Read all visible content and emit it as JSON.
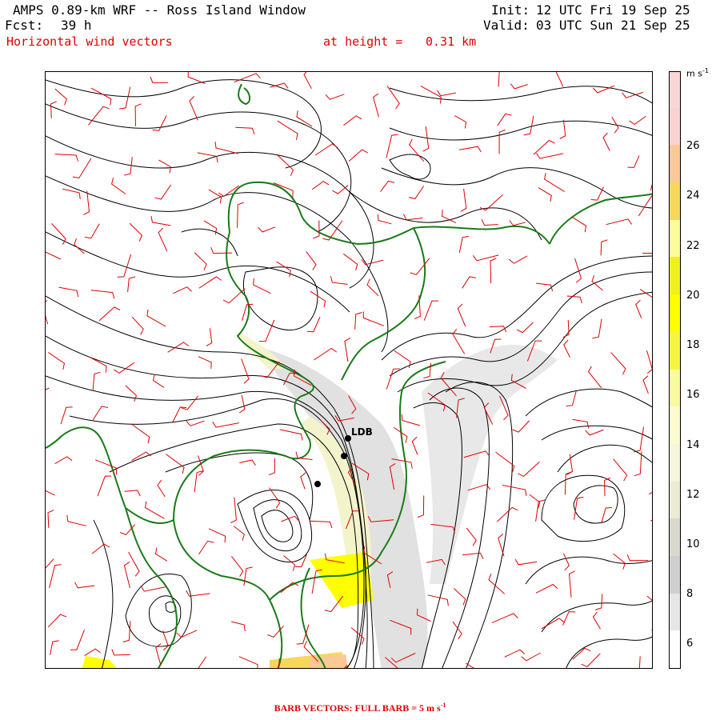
{
  "header": {
    "model_title": "AMPS 0.89-km WRF -- Ross Island Window",
    "forecast_label": "Fcst:",
    "forecast_hours": "39 h",
    "field_name": "Horizontal wind vectors",
    "height_label": "at height =",
    "height_value": "0.31 km",
    "init_label": "Init:",
    "init_time": "12 UTC Fri 19 Sep 25",
    "valid_label": "Valid:",
    "valid_time": "03 UTC Sun 21 Sep 25"
  },
  "colorbar": {
    "unit": "m s",
    "unit_exp": "-1",
    "ticks": [
      "26",
      "24",
      "22",
      "20",
      "18",
      "16",
      "14",
      "12",
      "10",
      "8",
      "6"
    ],
    "colors": [
      "#ffffff",
      "#e6e6e6",
      "#cfcfcf",
      "#d8d8cc",
      "#ececd4",
      "#f6f6dc",
      "#fbfbcf",
      "#fafaa0",
      "#f6f642",
      "#ffff00",
      "#f0f020",
      "#fcfc9c",
      "#f7d75a",
      "#fbc898",
      "#fad2d2",
      "#fbd6d6"
    ]
  },
  "map": {
    "station_label": "LDB",
    "colors": {
      "coast": "#1a7a1a",
      "barb": "#e00000",
      "contour": "#000000"
    }
  },
  "footer": {
    "text": "BARB VECTORS:  FULL BARB = 5 m s"
  },
  "footer_exp": "-1"
}
